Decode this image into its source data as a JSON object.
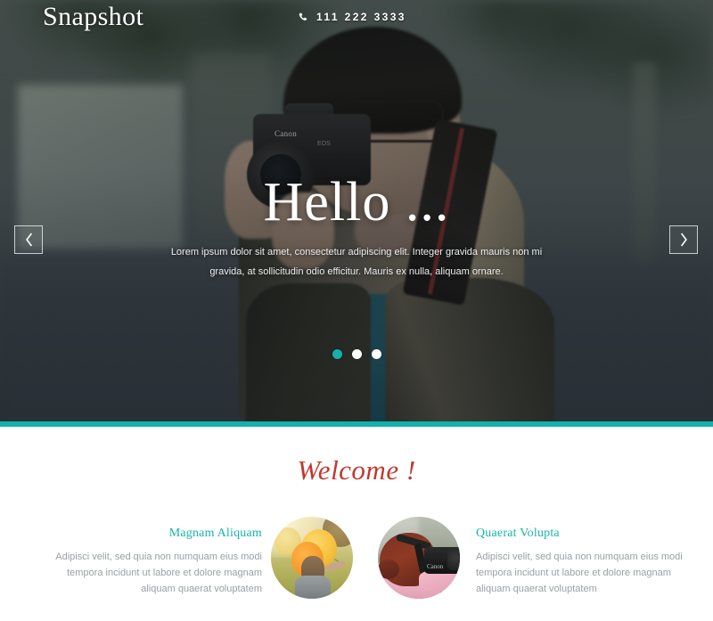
{
  "header": {
    "logo": "Snapshot",
    "phone_icon": "phone-icon",
    "phone": "111 222 3333"
  },
  "hero": {
    "title": "Hello ...",
    "paragraph": "Lorem ipsum dolor sit amet, consectetur adipiscing elit. Integer gravida mauris non mi gravida, at sollicitudin odio efficitur. Mauris ex nulla, aliquam ornare.",
    "prev_icon": "chevron-left-icon",
    "next_icon": "chevron-right-icon",
    "slide_count": 3,
    "active_slide": 1,
    "image_alt": "photographer-with-canon-camera"
  },
  "welcome": {
    "title": "Welcome !",
    "columns": [
      {
        "title": "Magnam Aliquam",
        "body": "Adipisci velit, sed quia non numquam eius modi tempora incidunt ut labore et dolore magnam aliquam quaerat voluptatem",
        "image_alt": "woman-with-balloons-circle"
      },
      {
        "title": "Quaerat Volupta",
        "body": "Adipisci velit, sed quia non numquam eius modi tempora incidunt ut labore et dolore magnam aliquam quaerat voluptatem",
        "image_alt": "woman-with-camera-circle"
      }
    ]
  },
  "colors": {
    "teal": "#12b2ab",
    "teal_heading": "#19b4a8",
    "welcome_red": "#c0392f",
    "body_text": "#9aa0a3",
    "white": "#ffffff"
  },
  "camera": {
    "brand": "Canon",
    "badge": "EOS"
  }
}
